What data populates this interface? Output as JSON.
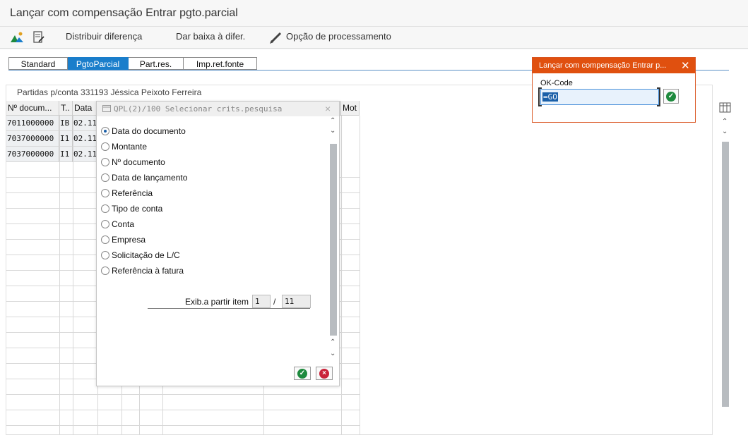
{
  "window": {
    "title": "Lançar com compensação Entrar pgto.parcial"
  },
  "toolbar": {
    "icons": [
      "mountain-icon",
      "document-edit-icon"
    ],
    "buttons": [
      "Distribuir diferença",
      "Dar baixa à difer.",
      "Opção de processamento"
    ],
    "pencil_icon": "pencil-icon"
  },
  "tabs": [
    {
      "label": "Standard",
      "active": false
    },
    {
      "label": "PgtoParcial",
      "active": true
    },
    {
      "label": "Part.res.",
      "active": false
    },
    {
      "label": "Imp.ret.fonte",
      "active": false
    }
  ],
  "panel": {
    "title": "Partidas p/conta 331193 Jéssica Peixoto Ferreira",
    "columns": [
      "Nº docum...",
      "T..",
      "Data",
      "Mot"
    ],
    "rows": [
      [
        "7011000000",
        "IB",
        "02.11"
      ],
      [
        "7037000000",
        "I1",
        "02.11"
      ],
      [
        "7037000000",
        "I1",
        "02.11"
      ]
    ]
  },
  "search_dialog": {
    "title": "QPL(2)/100 Selecionar crits.pesquisa",
    "options": [
      "Data do documento",
      "Montante",
      "Nº documento",
      "Data de lançamento",
      "Referência",
      "Tipo de conta",
      "Conta",
      "Empresa",
      "Solicitação de L/C",
      "Referência à fatura"
    ],
    "selected_index": 0,
    "range_label": "Exib.a partir item",
    "range_from": "1",
    "range_sep": "/",
    "range_total": "11",
    "ok_icon": "check-icon",
    "cancel_icon": "cancel-icon"
  },
  "okcode_popup": {
    "title": "Lançar com compensação Entrar p...",
    "label": "OK-Code",
    "value": "=GO",
    "confirm_icon": "check-icon"
  },
  "colors": {
    "accent": "#1a7ecb",
    "popup_header": "#e0500f",
    "confirm": "#1e8a3e",
    "cancel": "#c9233a"
  }
}
